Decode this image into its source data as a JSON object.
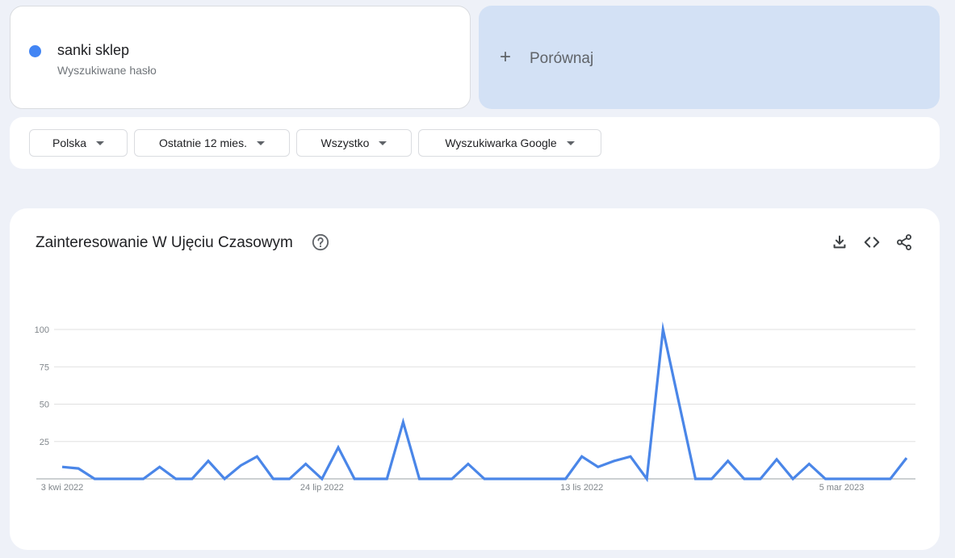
{
  "search": {
    "term": "sanki sklep",
    "term_subtitle": "Wyszukiwane hasło",
    "term_color": "#4285f4"
  },
  "compare": {
    "label": "Porównaj",
    "icon": "plus-icon"
  },
  "filters": [
    {
      "label": "Polska",
      "icon": "caret-down-icon"
    },
    {
      "label": "Ostatnie 12 mies.",
      "icon": "caret-down-icon"
    },
    {
      "label": "Wszystko",
      "icon": "caret-down-icon"
    },
    {
      "label": "Wyszukiwarka Google",
      "icon": "caret-down-icon"
    }
  ],
  "chart_panel": {
    "title": "Zainteresowanie W Ujęciu Czasowym",
    "icons": [
      "help-icon",
      "download-icon",
      "embed-code-icon",
      "share-icon"
    ]
  },
  "colors": {
    "line": "#4a86e8",
    "page_bg": "#eef1f8",
    "compare_bg": "#d3e1f5"
  },
  "chart_data": {
    "type": "line",
    "title": "",
    "y_ticks": [
      "100",
      "75",
      "50",
      "25"
    ],
    "x_tick_labels": [
      "3 kwi 2022",
      "24 lip 2022",
      "13 lis 2022",
      "5 mar 2023"
    ],
    "x_tick_indices": [
      0,
      16,
      32,
      48
    ],
    "ylim": [
      0,
      100
    ],
    "grid": true,
    "legend": "none",
    "series": [
      {
        "values": [
          8,
          7,
          0,
          0,
          0,
          0,
          8,
          0,
          0,
          12,
          0,
          9,
          15,
          0,
          0,
          10,
          0,
          21,
          0,
          0,
          0,
          38,
          0,
          0,
          0,
          10,
          0,
          0,
          0,
          0,
          0,
          0,
          15,
          8,
          12,
          15,
          0,
          100,
          50,
          0,
          0,
          12,
          0,
          0,
          13,
          0,
          10,
          0,
          0,
          0,
          0,
          0,
          14
        ]
      }
    ]
  }
}
